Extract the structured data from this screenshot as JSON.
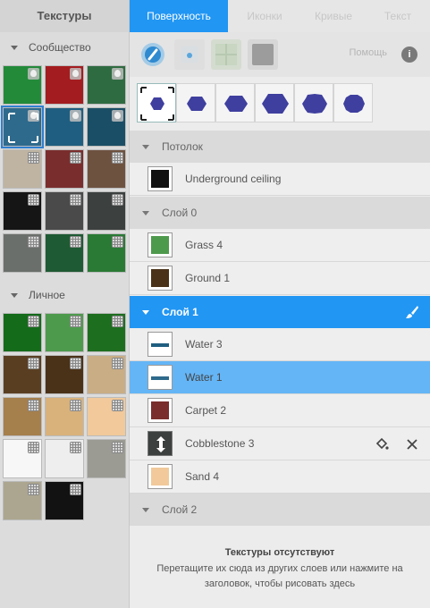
{
  "left_panel": {
    "title": "Текстуры",
    "sections": [
      {
        "label": "Сообщество"
      },
      {
        "label": "Личное"
      }
    ],
    "community_tiles": [
      {
        "color": "#238a3a",
        "badge": "drop"
      },
      {
        "color": "#a31c1f",
        "badge": "drop"
      },
      {
        "color": "#2f6b41",
        "badge": "drop"
      },
      {
        "color": "#2e6a8c",
        "badge": "drop",
        "selected": true
      },
      {
        "color": "#1f5e80",
        "badge": "drop"
      },
      {
        "color": "#1a4e66",
        "badge": "drop"
      },
      {
        "color": "#bfb4a2",
        "badge": "pattern"
      },
      {
        "color": "#7a2d2d",
        "badge": "pattern"
      },
      {
        "color": "#6e5240",
        "badge": "pattern"
      },
      {
        "color": "#151515",
        "badge": "pattern"
      },
      {
        "color": "#4a4a4a",
        "badge": "pattern"
      },
      {
        "color": "#3c403e",
        "badge": "pattern"
      },
      {
        "color": "#6b6f6b",
        "badge": "pattern"
      },
      {
        "color": "#1e5a33",
        "badge": "pattern"
      },
      {
        "color": "#2a7a35",
        "badge": "pattern"
      }
    ],
    "personal_tiles": [
      {
        "color": "#146b1a",
        "badge": "pattern"
      },
      {
        "color": "#4e9a4d",
        "badge": "pattern"
      },
      {
        "color": "#1d6e1f",
        "badge": "pattern"
      },
      {
        "color": "#5a3e22",
        "badge": "pattern"
      },
      {
        "color": "#4a3218",
        "badge": "pattern"
      },
      {
        "color": "#c9ad85",
        "badge": "pattern"
      },
      {
        "color": "#a57f4c",
        "badge": "pattern"
      },
      {
        "color": "#d9b27b",
        "badge": "pattern"
      },
      {
        "color": "#f1c99b",
        "badge": "pattern"
      },
      {
        "color": "#f7f7f7",
        "badge": "pattern"
      },
      {
        "color": "#eeeeee",
        "badge": "pattern"
      },
      {
        "color": "#9b9b94",
        "badge": "pattern"
      },
      {
        "color": "#aca691",
        "badge": "pattern"
      },
      {
        "color": "#121212",
        "badge": "pattern"
      }
    ]
  },
  "tabs": [
    {
      "label": "Поверхность",
      "active": true
    },
    {
      "label": "Иконки"
    },
    {
      "label": "Кривые"
    },
    {
      "label": "Текст"
    }
  ],
  "toolbar": {
    "help_label": "Помощь",
    "info_label": "i",
    "tools": [
      "brush-tool",
      "select-tool",
      "grid-tool",
      "fill-tool"
    ]
  },
  "layers": [
    {
      "title": "Потолок",
      "items": [
        {
          "name": "Underground ceiling",
          "color": "#111111",
          "style": "fill"
        }
      ]
    },
    {
      "title": "Слой 0",
      "items": [
        {
          "name": "Grass 4",
          "color": "#4e9a4d",
          "style": "fill"
        },
        {
          "name": "Ground 1",
          "color": "#4a3218",
          "style": "fill"
        }
      ]
    },
    {
      "title": "Слой 1",
      "active": true,
      "items": [
        {
          "name": "Water 3",
          "color": "#1f5e80",
          "style": "line"
        },
        {
          "name": "Water 1",
          "color": "#2e6a8c",
          "style": "line",
          "selected": true
        },
        {
          "name": "Carpet 2",
          "color": "#7a2d2d",
          "style": "fill"
        },
        {
          "name": "Cobblestone 3",
          "color": "#3c403e",
          "style": "drag",
          "hovered": true
        },
        {
          "name": "Sand 4",
          "color": "#f1c99b",
          "style": "fill"
        }
      ]
    },
    {
      "title": "Слой 2",
      "items": []
    }
  ],
  "empty_state": {
    "title": "Текстуры отсутствуют",
    "description": "Перетащите их сюда из других слоев или нажмите на заголовок, чтобы рисовать здесь"
  },
  "colors": {
    "accent": "#2196f3",
    "selection": "#64b5f6",
    "brush_shape": "#3f3f9f"
  }
}
